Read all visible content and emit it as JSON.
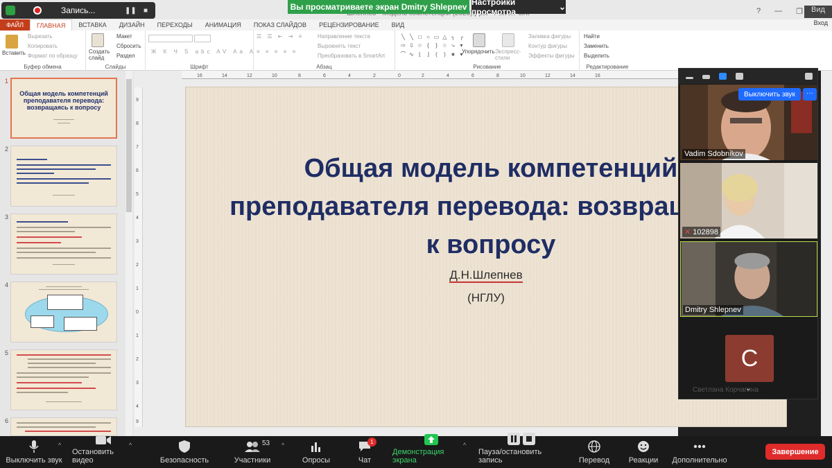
{
  "zoom_top": {
    "recording_label": "Запись...",
    "viewing_banner": "Вы просматриваете экран Dmitry Shlepnev",
    "view_options": "Настройки просмотра",
    "window_title": "Шлепнев - Модель компетенций (2020).pptx - PowerPoint",
    "video_tab": "Вид"
  },
  "ribbon": {
    "tabs": [
      "ФАЙЛ",
      "ГЛАВНАЯ",
      "ВСТАВКА",
      "ДИЗАЙН",
      "ПЕРЕХОДЫ",
      "АНИМАЦИЯ",
      "ПОКАЗ СЛАЙДОВ",
      "РЕЦЕНЗИРОВАНИЕ",
      "ВИД"
    ],
    "login": "Вход",
    "clipboard": {
      "paste": "Вставить",
      "cut": "Вырезать",
      "copy": "Копировать",
      "format": "Формат по образцу",
      "label": "Буфер обмена"
    },
    "slides": {
      "new": "Создать слайд",
      "layout": "Макет",
      "reset": "Сбросить",
      "section": "Раздел",
      "label": "Слайды"
    },
    "font": {
      "label": "Шрифт",
      "buttons": "Ж К Ч S abc AV Aa A"
    },
    "paragraph": {
      "direction": "Направление текста",
      "align": "Выровнять текст",
      "smartart": "Преобразовать в SmartArt",
      "label": "Абзац"
    },
    "drawing": {
      "arrange": "Упорядочить",
      "styles": "Экспресс-стили",
      "fill": "Заливка фигуры",
      "outline": "Контур фигуры",
      "effects": "Эффекты фигуры",
      "label": "Рисование"
    },
    "editing": {
      "find": "Найти",
      "replace": "Заменить",
      "select": "Выделить",
      "label": "Редактирование"
    }
  },
  "thumbnails": [
    {
      "num": "1",
      "title": "Общая модель компетенций преподавателя перевода: возвращаясь к вопросу"
    },
    {
      "num": "2",
      "text": "Цель: представить общую модель (рамочную конструкцию) компетенций преподавателя перевода"
    },
    {
      "num": "3",
      "text": "Модель (рамочная конструкция)"
    },
    {
      "num": "4",
      "text": "Модель (рамочная конструкция) компетенций преподавателя перевода"
    },
    {
      "num": "5",
      "text": "Проф. перевод. компетенция"
    },
    {
      "num": "6",
      "text": ""
    }
  ],
  "slide": {
    "title": "Общая модель компетенций преподавателя перевода: возвращаясь к вопросу",
    "author": "Д.Н.Шлепнев",
    "org": "(НГЛУ)"
  },
  "participants": {
    "unmute_button": "Выключить звук",
    "more_button": "···",
    "tiles": [
      {
        "name": "Vadim Sdobnikov"
      },
      {
        "name": "102898"
      },
      {
        "name": "Dmitry Shlepnev"
      }
    ],
    "avatar_letter": "C",
    "avatar_name": "Светлана Корчагина"
  },
  "toolbar": {
    "mute": "Выключить звук",
    "video": "Остановить видео",
    "security": "Безопасность",
    "participants": "Участники",
    "participants_count": "53",
    "polls": "Опросы",
    "chat": "Чат",
    "chat_badge": "1",
    "share": "Демонстрация экрана",
    "pause_record": "Пауза/остановить запись",
    "translate": "Перевод",
    "reactions": "Реакции",
    "more": "Дополнительно",
    "end": "Завершение"
  },
  "colors": {
    "share_green": "#2fa04a",
    "end_red": "#e02b2b",
    "slide_title": "#1f2d64",
    "ppt_orange": "#c43e1c",
    "unmute_blue": "#1f6bff"
  }
}
